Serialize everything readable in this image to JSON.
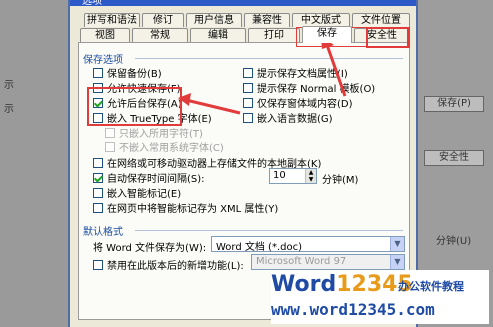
{
  "dialog": {
    "title": "选项"
  },
  "tabs_row1": [
    {
      "label": "拼写和语法"
    },
    {
      "label": "修订"
    },
    {
      "label": "用户信息"
    },
    {
      "label": "兼容性"
    },
    {
      "label": "中文版式"
    },
    {
      "label": "文件位置"
    }
  ],
  "tabs_row2": [
    {
      "label": "视图"
    },
    {
      "label": "常规"
    },
    {
      "label": "编辑"
    },
    {
      "label": "打印"
    },
    {
      "label": "保存",
      "active": true
    },
    {
      "label": "安全性"
    }
  ],
  "save_options": {
    "title": "保存选项",
    "left": [
      {
        "label": "保留备份(B)",
        "checked": false
      },
      {
        "label": "允许快速保存(F)",
        "checked": false
      },
      {
        "label": "允许后台保存(A)",
        "checked": true
      },
      {
        "label": "嵌入 TrueType 字体(E)",
        "checked": false
      },
      {
        "label": "只嵌入所用字符(T)",
        "checked": false,
        "disabled": true
      },
      {
        "label": "不嵌入常用系统字体(C)",
        "checked": false,
        "disabled": true
      }
    ],
    "right": [
      {
        "label": "提示保存文档属性(I)",
        "checked": false
      },
      {
        "label": "提示保存 Normal 模板(O)",
        "checked": false
      },
      {
        "label": "仅保存窗体域内容(D)",
        "checked": false
      },
      {
        "label": "嵌入语言数据(G)",
        "checked": false
      }
    ],
    "full": [
      {
        "label": "在网络或可移动驱动器上存储文件的本地副本(K)",
        "checked": false
      },
      {
        "label": "自动保存时间间隔(S):",
        "checked": true
      },
      {
        "label": "嵌入智能标记(E)",
        "checked": false
      },
      {
        "label": "在网页中将智能标记存为 XML 属性(Y)",
        "checked": false
      }
    ],
    "autosave_minutes": "10",
    "minutes_unit": "分钟(M)"
  },
  "default_format": {
    "title": "默认格式",
    "save_as_label": "将 Word 文件保存为(W):",
    "save_as_value": "Word 文档 (*.doc)",
    "disable_features_label": "禁用在此版本后的新增功能(L):",
    "disable_features_value": "Microsoft Word 97"
  },
  "background": {
    "right_buttons": [
      "保存(P)",
      "安全性"
    ],
    "right_text": "分钟(U)",
    "left_text": [
      "示",
      "示"
    ]
  },
  "watermark": {
    "logo_word": "Word",
    "logo_num": "12345",
    "cn": "办公软件教程",
    "url": "www.word12345.com"
  },
  "colors": {
    "accent": "#2c58c8",
    "highlight": "#e23b3b",
    "section": "#1a4ea3"
  }
}
